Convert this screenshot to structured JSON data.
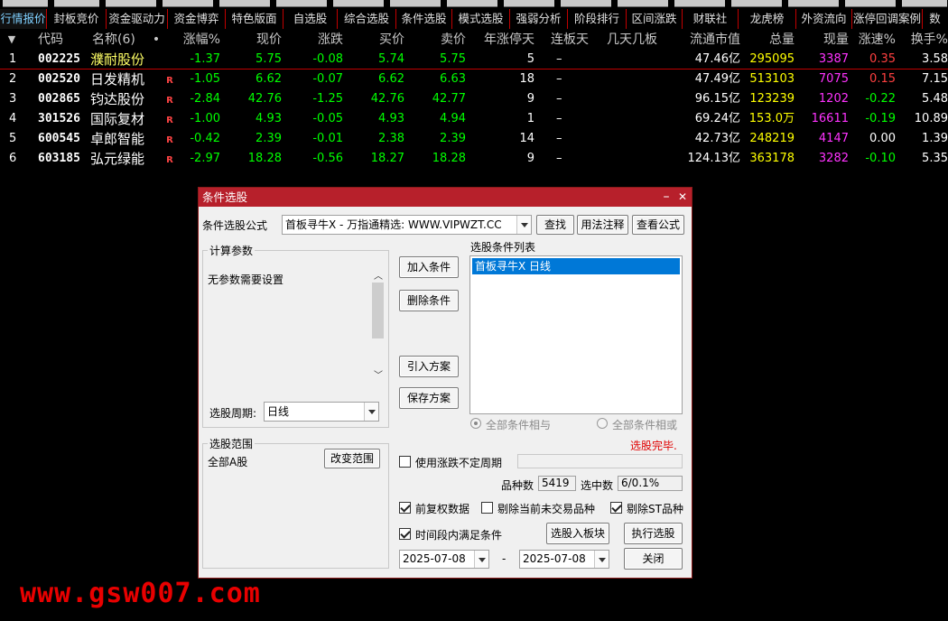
{
  "tabs": [
    "行情报价",
    "封板竞价",
    "资金驱动力",
    "资金博弈",
    "特色版面",
    "自选股",
    "综合选股",
    "条件选股",
    "模式选股",
    "强弱分析",
    "阶段排行",
    "区间涨跌",
    "财联社",
    "龙虎榜",
    "外资流向",
    "涨停回调案例",
    "数"
  ],
  "table": {
    "headers": {
      "sort": "▼",
      "code": "代码",
      "name": "名称(6)",
      "dot": "•",
      "pct": "涨幅%",
      "price": "现价",
      "change": "涨跌",
      "bid": "买价",
      "ask": "卖价",
      "ztdays": "年涨停天",
      "lbdays": "连板天",
      "jtjb": "几天几板",
      "mktcap": "流通市值",
      "volume": "总量",
      "curvol": "现量",
      "speed": "涨速%",
      "turnover": "换手%"
    },
    "rows": [
      {
        "idx": "1",
        "code": "002225",
        "name": "濮耐股份",
        "r": "",
        "pct": "-1.37",
        "price": "5.75",
        "change": "-0.08",
        "bid": "5.74",
        "ask": "5.75",
        "ztdays": "5",
        "lbdays": "–",
        "mktcap": "47.46亿",
        "volume": "295095",
        "curvol": "3387",
        "speed": "0.35",
        "turnover": "3.58"
      },
      {
        "idx": "2",
        "code": "002520",
        "name": "日发精机",
        "r": "R",
        "pct": "-1.05",
        "price": "6.62",
        "change": "-0.07",
        "bid": "6.62",
        "ask": "6.63",
        "ztdays": "18",
        "lbdays": "–",
        "mktcap": "47.49亿",
        "volume": "513103",
        "curvol": "7075",
        "speed": "0.15",
        "turnover": "7.15"
      },
      {
        "idx": "3",
        "code": "002865",
        "name": "钧达股份",
        "r": "R",
        "pct": "-2.84",
        "price": "42.76",
        "change": "-1.25",
        "bid": "42.76",
        "ask": "42.77",
        "ztdays": "9",
        "lbdays": "–",
        "mktcap": "96.15亿",
        "volume": "123239",
        "curvol": "1202",
        "speed": "-0.22",
        "turnover": "5.48"
      },
      {
        "idx": "4",
        "code": "301526",
        "name": "国际复材",
        "r": "R",
        "pct": "-1.00",
        "price": "4.93",
        "change": "-0.05",
        "bid": "4.93",
        "ask": "4.94",
        "ztdays": "1",
        "lbdays": "–",
        "mktcap": "69.24亿",
        "volume": "153.0万",
        "curvol": "16611",
        "speed": "-0.19",
        "turnover": "10.89"
      },
      {
        "idx": "5",
        "code": "600545",
        "name": "卓郎智能",
        "r": "R",
        "pct": "-0.42",
        "price": "2.39",
        "change": "-0.01",
        "bid": "2.38",
        "ask": "2.39",
        "ztdays": "14",
        "lbdays": "–",
        "mktcap": "42.73亿",
        "volume": "248219",
        "curvol": "4147",
        "speed": "0.00",
        "turnover": "1.39"
      },
      {
        "idx": "6",
        "code": "603185",
        "name": "弘元绿能",
        "r": "R",
        "pct": "-2.97",
        "price": "18.28",
        "change": "-0.56",
        "bid": "18.27",
        "ask": "18.28",
        "ztdays": "9",
        "lbdays": "–",
        "mktcap": "124.13亿",
        "volume": "363178",
        "curvol": "3282",
        "speed": "-0.10",
        "turnover": "5.35"
      }
    ]
  },
  "dialog": {
    "title": "条件选股",
    "minimize": "–",
    "close": "✕",
    "formula_label": "条件选股公式",
    "formula_value": "首板寻牛X  -  万指通精选: WWW.VIPWZT.CC",
    "btn_find": "查找",
    "btn_usage": "用法注释",
    "btn_view": "查看公式",
    "params_group": "计算参数",
    "params_text": "无参数需要设置",
    "period_label": "选股周期:",
    "period_value": "日线",
    "btn_add": "加入条件",
    "btn_delete": "删除条件",
    "btn_import": "引入方案",
    "btn_save": "保存方案",
    "list_label": "选股条件列表",
    "list_items": [
      "首板寻牛X  日线"
    ],
    "radio_and": "全部条件相与",
    "radio_or": "全部条件相或",
    "status": "选股完毕.",
    "scope_group": "选股范围",
    "scope_value": "全部A股",
    "btn_scope": "改变范围",
    "chk_uncertain": "使用涨跌不定周期",
    "count_label": "品种数",
    "count_value": "5419",
    "selected_label": "选中数",
    "selected_value": "6/0.1%",
    "chk_fq": "前复权数据",
    "chk_untraded": "剔除当前未交易品种",
    "chk_st": "剔除ST品种",
    "chk_period": "时间段内满足条件",
    "btn_to_block": "选股入板块",
    "btn_run": "执行选股",
    "date_from": "2025-07-08",
    "date_sep": "-",
    "date_to": "2025-07-08",
    "btn_close": "关闭"
  },
  "watermark": "www.gsw007.com",
  "colors": {
    "up_red": "#ff4040",
    "down_green": "#00ff00",
    "title_bar": "#b7202b",
    "tab_border": "#c00000",
    "watermark": "#e80000"
  }
}
